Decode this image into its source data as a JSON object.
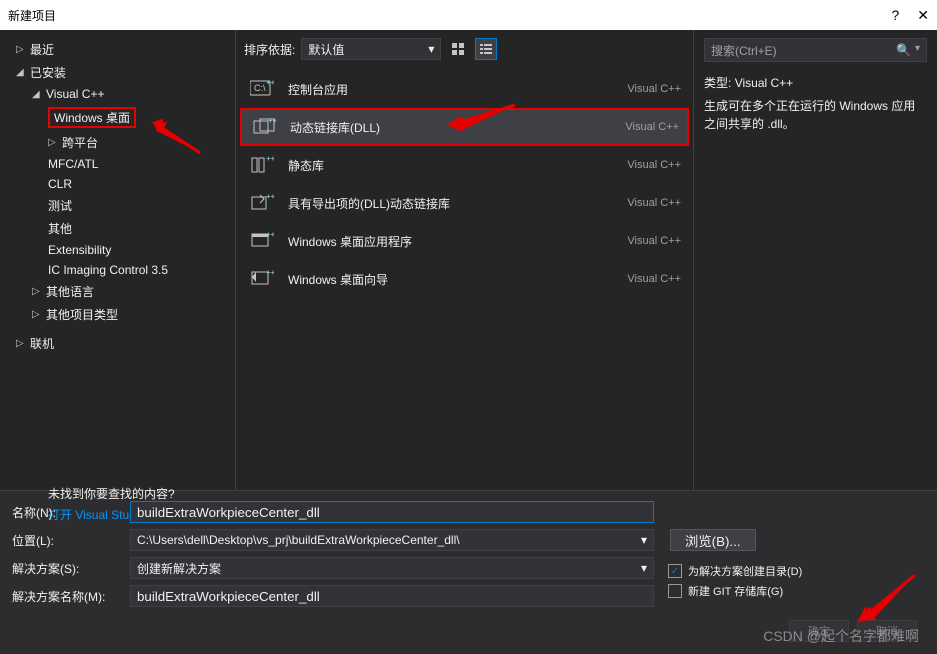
{
  "title": "新建项目",
  "tree": {
    "recent": "最近",
    "installed": "已安装",
    "vcpp": "Visual C++",
    "windows_desktop": "Windows 桌面",
    "cross_platform": "跨平台",
    "mfc": "MFC/ATL",
    "clr": "CLR",
    "test": "测试",
    "other": "其他",
    "extensibility": "Extensibility",
    "ic": "IC Imaging Control 3.5",
    "other_lang": "其他语言",
    "other_proj": "其他项目类型",
    "online": "联机",
    "help_q": "未找到你要查找的内容?",
    "help_link": "打开 Visual Studio 安装程序"
  },
  "toolbar": {
    "sort_label": "排序依据:",
    "sort_value": "默认值"
  },
  "templates": [
    {
      "name": "控制台应用",
      "lang": "Visual C++"
    },
    {
      "name": "动态链接库(DLL)",
      "lang": "Visual C++"
    },
    {
      "name": "静态库",
      "lang": "Visual C++"
    },
    {
      "name": "具有导出项的(DLL)动态链接库",
      "lang": "Visual C++"
    },
    {
      "name": "Windows 桌面应用程序",
      "lang": "Visual C++"
    },
    {
      "name": "Windows 桌面向导",
      "lang": "Visual C++"
    }
  ],
  "right": {
    "search_placeholder": "搜索(Ctrl+E)",
    "type_label": "类型:",
    "type_value": "Visual C++",
    "desc": "生成可在多个正在运行的 Windows 应用之间共享的 .dll。"
  },
  "form": {
    "name_label": "名称(N):",
    "name_value": "buildExtraWorkpieceCenter_dll",
    "location_label": "位置(L):",
    "location_value": "C:\\Users\\dell\\Desktop\\vs_prj\\buildExtraWorkpieceCenter_dll\\",
    "solution_label": "解决方案(S):",
    "solution_value": "创建新解决方案",
    "solution_name_label": "解决方案名称(M):",
    "solution_name_value": "buildExtraWorkpieceCenter_dll",
    "browse_btn": "浏览(B)...",
    "check1": "为解决方案创建目录(D)",
    "check2": "新建 GIT 存储库(G)",
    "ok_btn": "确定",
    "cancel_btn": "取消"
  },
  "watermark": "CSDN @起个名字都难啊"
}
